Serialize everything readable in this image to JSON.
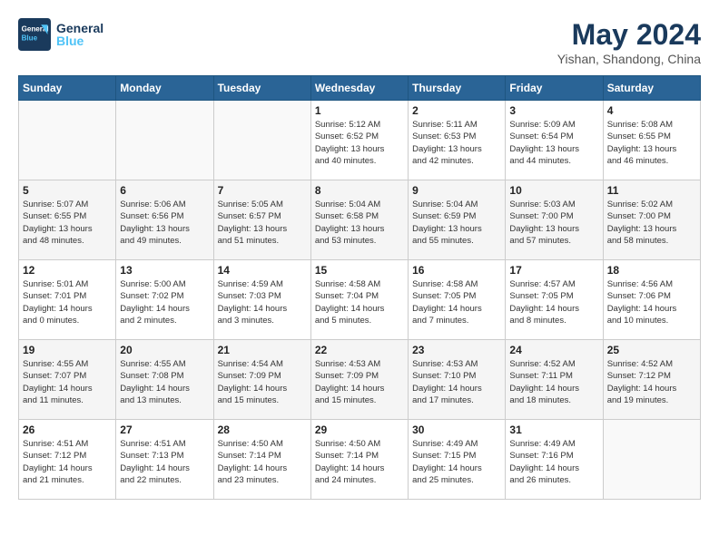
{
  "header": {
    "logo_line1": "General",
    "logo_line2": "Blue",
    "month_year": "May 2024",
    "location": "Yishan, Shandong, China"
  },
  "weekdays": [
    "Sunday",
    "Monday",
    "Tuesday",
    "Wednesday",
    "Thursday",
    "Friday",
    "Saturday"
  ],
  "weeks": [
    [
      {
        "day": "",
        "info": ""
      },
      {
        "day": "",
        "info": ""
      },
      {
        "day": "",
        "info": ""
      },
      {
        "day": "1",
        "info": "Sunrise: 5:12 AM\nSunset: 6:52 PM\nDaylight: 13 hours\nand 40 minutes."
      },
      {
        "day": "2",
        "info": "Sunrise: 5:11 AM\nSunset: 6:53 PM\nDaylight: 13 hours\nand 42 minutes."
      },
      {
        "day": "3",
        "info": "Sunrise: 5:09 AM\nSunset: 6:54 PM\nDaylight: 13 hours\nand 44 minutes."
      },
      {
        "day": "4",
        "info": "Sunrise: 5:08 AM\nSunset: 6:55 PM\nDaylight: 13 hours\nand 46 minutes."
      }
    ],
    [
      {
        "day": "5",
        "info": "Sunrise: 5:07 AM\nSunset: 6:55 PM\nDaylight: 13 hours\nand 48 minutes."
      },
      {
        "day": "6",
        "info": "Sunrise: 5:06 AM\nSunset: 6:56 PM\nDaylight: 13 hours\nand 49 minutes."
      },
      {
        "day": "7",
        "info": "Sunrise: 5:05 AM\nSunset: 6:57 PM\nDaylight: 13 hours\nand 51 minutes."
      },
      {
        "day": "8",
        "info": "Sunrise: 5:04 AM\nSunset: 6:58 PM\nDaylight: 13 hours\nand 53 minutes."
      },
      {
        "day": "9",
        "info": "Sunrise: 5:04 AM\nSunset: 6:59 PM\nDaylight: 13 hours\nand 55 minutes."
      },
      {
        "day": "10",
        "info": "Sunrise: 5:03 AM\nSunset: 7:00 PM\nDaylight: 13 hours\nand 57 minutes."
      },
      {
        "day": "11",
        "info": "Sunrise: 5:02 AM\nSunset: 7:00 PM\nDaylight: 13 hours\nand 58 minutes."
      }
    ],
    [
      {
        "day": "12",
        "info": "Sunrise: 5:01 AM\nSunset: 7:01 PM\nDaylight: 14 hours\nand 0 minutes."
      },
      {
        "day": "13",
        "info": "Sunrise: 5:00 AM\nSunset: 7:02 PM\nDaylight: 14 hours\nand 2 minutes."
      },
      {
        "day": "14",
        "info": "Sunrise: 4:59 AM\nSunset: 7:03 PM\nDaylight: 14 hours\nand 3 minutes."
      },
      {
        "day": "15",
        "info": "Sunrise: 4:58 AM\nSunset: 7:04 PM\nDaylight: 14 hours\nand 5 minutes."
      },
      {
        "day": "16",
        "info": "Sunrise: 4:58 AM\nSunset: 7:05 PM\nDaylight: 14 hours\nand 7 minutes."
      },
      {
        "day": "17",
        "info": "Sunrise: 4:57 AM\nSunset: 7:05 PM\nDaylight: 14 hours\nand 8 minutes."
      },
      {
        "day": "18",
        "info": "Sunrise: 4:56 AM\nSunset: 7:06 PM\nDaylight: 14 hours\nand 10 minutes."
      }
    ],
    [
      {
        "day": "19",
        "info": "Sunrise: 4:55 AM\nSunset: 7:07 PM\nDaylight: 14 hours\nand 11 minutes."
      },
      {
        "day": "20",
        "info": "Sunrise: 4:55 AM\nSunset: 7:08 PM\nDaylight: 14 hours\nand 13 minutes."
      },
      {
        "day": "21",
        "info": "Sunrise: 4:54 AM\nSunset: 7:09 PM\nDaylight: 14 hours\nand 15 minutes."
      },
      {
        "day": "22",
        "info": "Sunrise: 4:53 AM\nSunset: 7:09 PM\nDaylight: 14 hours\nand 15 minutes."
      },
      {
        "day": "23",
        "info": "Sunrise: 4:53 AM\nSunset: 7:10 PM\nDaylight: 14 hours\nand 17 minutes."
      },
      {
        "day": "24",
        "info": "Sunrise: 4:52 AM\nSunset: 7:11 PM\nDaylight: 14 hours\nand 18 minutes."
      },
      {
        "day": "25",
        "info": "Sunrise: 4:52 AM\nSunset: 7:12 PM\nDaylight: 14 hours\nand 19 minutes."
      }
    ],
    [
      {
        "day": "26",
        "info": "Sunrise: 4:51 AM\nSunset: 7:12 PM\nDaylight: 14 hours\nand 21 minutes."
      },
      {
        "day": "27",
        "info": "Sunrise: 4:51 AM\nSunset: 7:13 PM\nDaylight: 14 hours\nand 22 minutes."
      },
      {
        "day": "28",
        "info": "Sunrise: 4:50 AM\nSunset: 7:14 PM\nDaylight: 14 hours\nand 23 minutes."
      },
      {
        "day": "29",
        "info": "Sunrise: 4:50 AM\nSunset: 7:14 PM\nDaylight: 14 hours\nand 24 minutes."
      },
      {
        "day": "30",
        "info": "Sunrise: 4:49 AM\nSunset: 7:15 PM\nDaylight: 14 hours\nand 25 minutes."
      },
      {
        "day": "31",
        "info": "Sunrise: 4:49 AM\nSunset: 7:16 PM\nDaylight: 14 hours\nand 26 minutes."
      },
      {
        "day": "",
        "info": ""
      }
    ]
  ]
}
